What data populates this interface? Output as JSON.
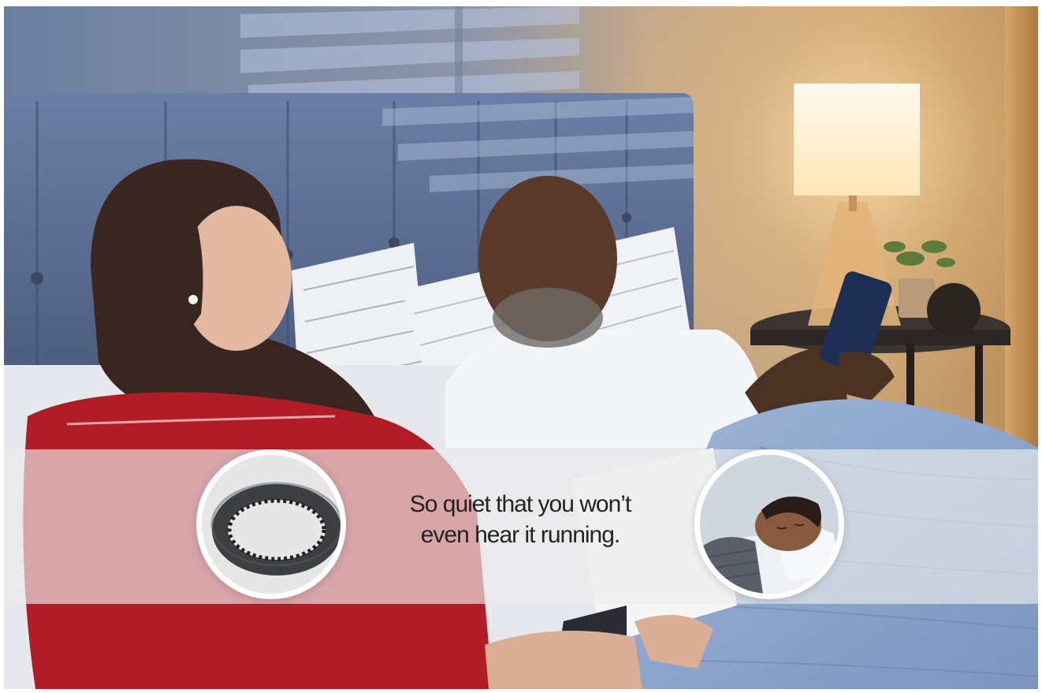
{
  "caption": {
    "line1": "So quiet that you won’t",
    "line2": "even hear it running."
  },
  "icons": {
    "left_inset": "timing-belt-icon",
    "right_inset": "sleeping-child-icon"
  },
  "colors": {
    "banner": "#ececec",
    "pajama_red": "#b11d26",
    "headboard": "#5b6f92",
    "lamp_glow": "#fff3d6",
    "caption_text": "#232323"
  }
}
